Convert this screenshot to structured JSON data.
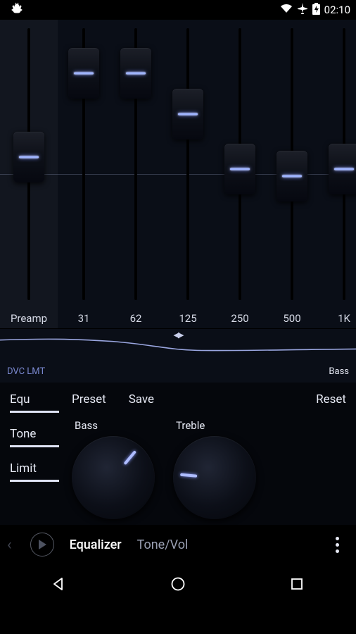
{
  "status": {
    "time": "02:10"
  },
  "eq": {
    "preamp_label": "Preamp",
    "preamp_value": 0,
    "bands": [
      {
        "freq": "31",
        "value": 35
      },
      {
        "freq": "62",
        "value": 35
      },
      {
        "freq": "125",
        "value": 18
      },
      {
        "freq": "250",
        "value": -5
      },
      {
        "freq": "500",
        "value": -8
      },
      {
        "freq": "1K",
        "value": -5
      }
    ]
  },
  "curve": {
    "left_label": "DVC LMT",
    "right_label": "Bass"
  },
  "toggles": {
    "equ": "Equ",
    "tone": "Tone",
    "limit": "Limit"
  },
  "buttons": {
    "preset": "Preset",
    "save": "Save",
    "reset": "Reset"
  },
  "knobs": {
    "bass_label": "Bass",
    "bass_angle": 40,
    "treble_label": "Treble",
    "treble_angle": -85
  },
  "tabs": {
    "equalizer": "Equalizer",
    "tonevol": "Tone/Vol"
  }
}
